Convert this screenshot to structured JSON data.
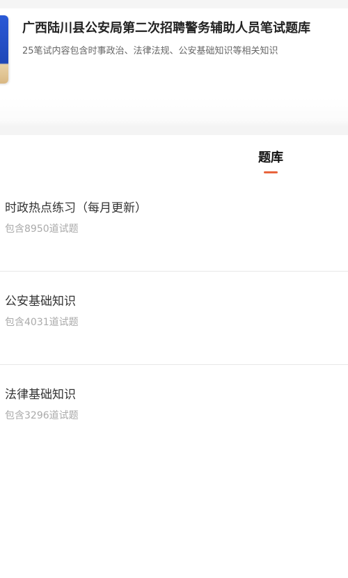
{
  "exam": {
    "title": "广西陆川县公安局第二次招聘警务辅助人员笔试题库",
    "description": "25笔试内容包含时事政治、法律法规、公安基础知识等相关知识"
  },
  "tabs": [
    {
      "label": "题库",
      "active": true
    }
  ],
  "banks": [
    {
      "name": "时政热点练习（每月更新）",
      "count_text": "包含8950道试题"
    },
    {
      "name": "公安基础知识",
      "count_text": "包含4031道试题"
    },
    {
      "name": "法律基础知识",
      "count_text": "包含3296道试题"
    }
  ],
  "colors": {
    "accent": "#e8643c",
    "cover": "#2a59d6"
  }
}
